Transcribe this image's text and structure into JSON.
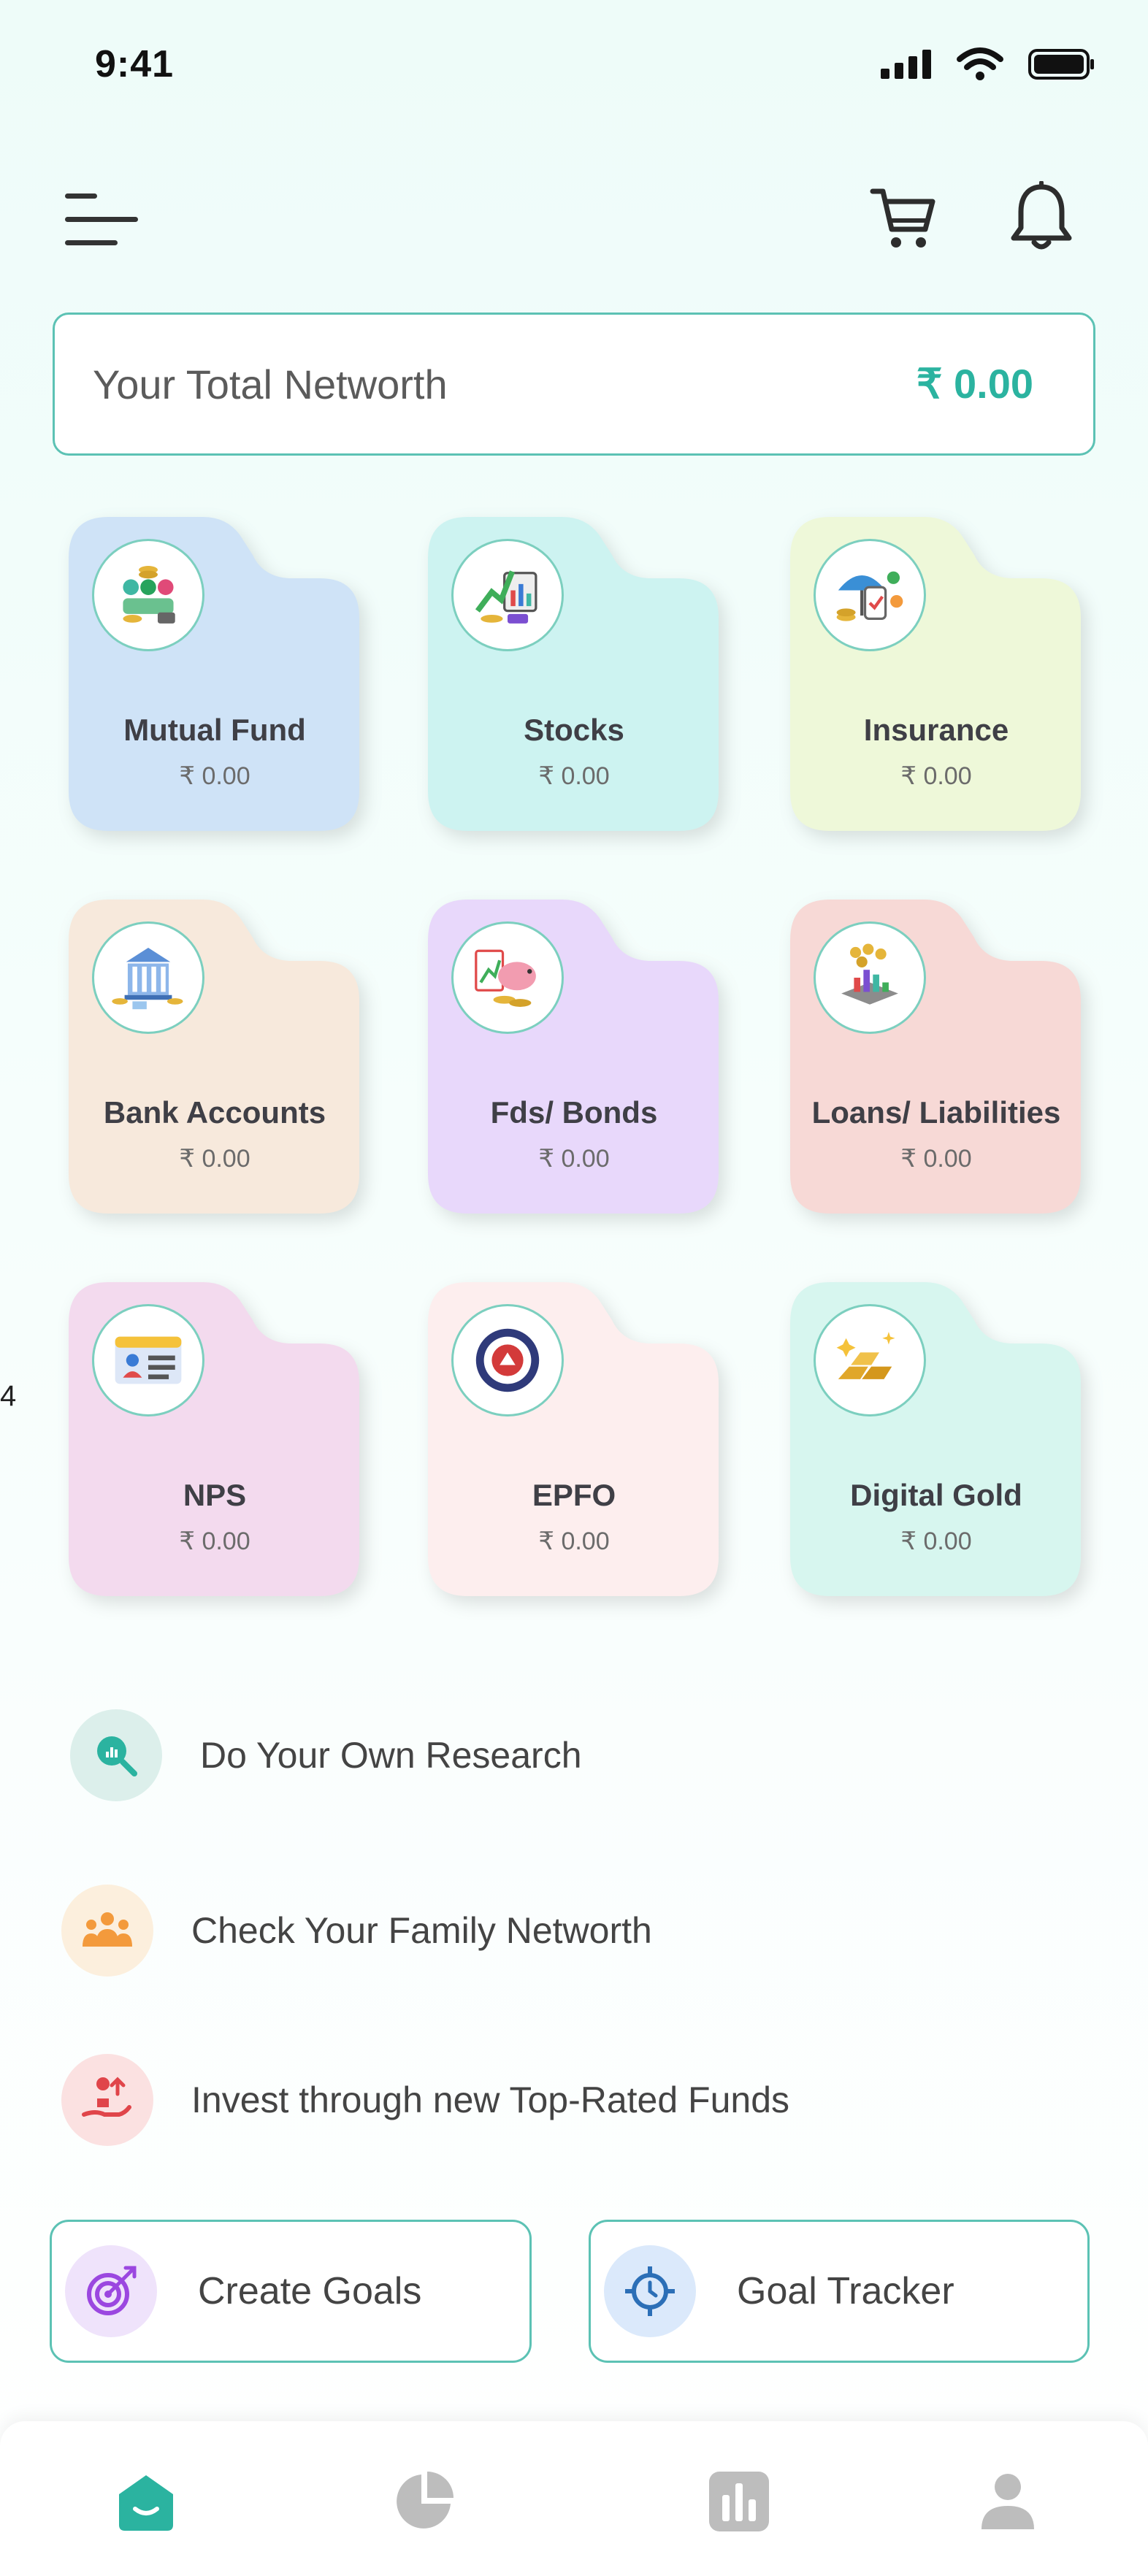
{
  "status_bar": {
    "time": "9:41"
  },
  "header": {
    "menu_icon": "menu-icon",
    "cart_icon": "cart-icon",
    "bell_icon": "bell-icon"
  },
  "networth": {
    "label": "Your Total Networth",
    "value": "₹ 0.00"
  },
  "assets": [
    {
      "title": "Mutual Fund",
      "amount": "₹ 0.00",
      "color": "#cfe3f7",
      "icon": "mutual-fund-icon"
    },
    {
      "title": "Stocks",
      "amount": "₹ 0.00",
      "color": "#cdf3f1",
      "icon": "stocks-chart-icon"
    },
    {
      "title": "Insurance",
      "amount": "₹ 0.00",
      "color": "#eef8d9",
      "icon": "insurance-umbrella-icon"
    },
    {
      "title": "Bank Accounts",
      "amount": "₹ 0.00",
      "color": "#f7e9dc",
      "icon": "bank-building-icon"
    },
    {
      "title": "Fds/ Bonds",
      "amount": "₹ 0.00",
      "color": "#e8d8fb",
      "icon": "piggy-bank-icon"
    },
    {
      "title": "Loans/ Liabilities",
      "amount": "₹ 0.00",
      "color": "#f7d9d6",
      "icon": "coins-chart-icon"
    },
    {
      "title": "NPS",
      "amount": "₹ 0.00",
      "color": "#f3daee",
      "icon": "id-card-icon"
    },
    {
      "title": "EPFO",
      "amount": "₹ 0.00",
      "color": "#fdeeee",
      "icon": "epfo-emblem-icon"
    },
    {
      "title": "Digital Gold",
      "amount": "₹ 0.00",
      "color": "#d7f6ef",
      "icon": "gold-bars-icon"
    }
  ],
  "links": [
    {
      "text": "Do Your Own Research",
      "bg": "#dcefeb",
      "icon": "research-search-icon"
    },
    {
      "text": "Check Your Family Networth",
      "bg": "#fcefdd",
      "icon": "family-icon"
    },
    {
      "text": "Invest through new Top-Rated Funds",
      "bg": "#fbe1e1",
      "icon": "invest-hand-icon"
    }
  ],
  "goals": {
    "create_label": "Create Goals",
    "tracker_label": "Goal Tracker"
  },
  "bottom_nav": [
    {
      "name": "home",
      "icon": "home-icon",
      "active": true
    },
    {
      "name": "portfolio",
      "icon": "pie-chart-icon",
      "active": false
    },
    {
      "name": "reports",
      "icon": "bar-chart-icon",
      "active": false
    },
    {
      "name": "profile",
      "icon": "user-icon",
      "active": false
    }
  ],
  "colors": {
    "accent": "#2bb3a0",
    "border": "#5cc2b4"
  },
  "edge_mark": "4"
}
